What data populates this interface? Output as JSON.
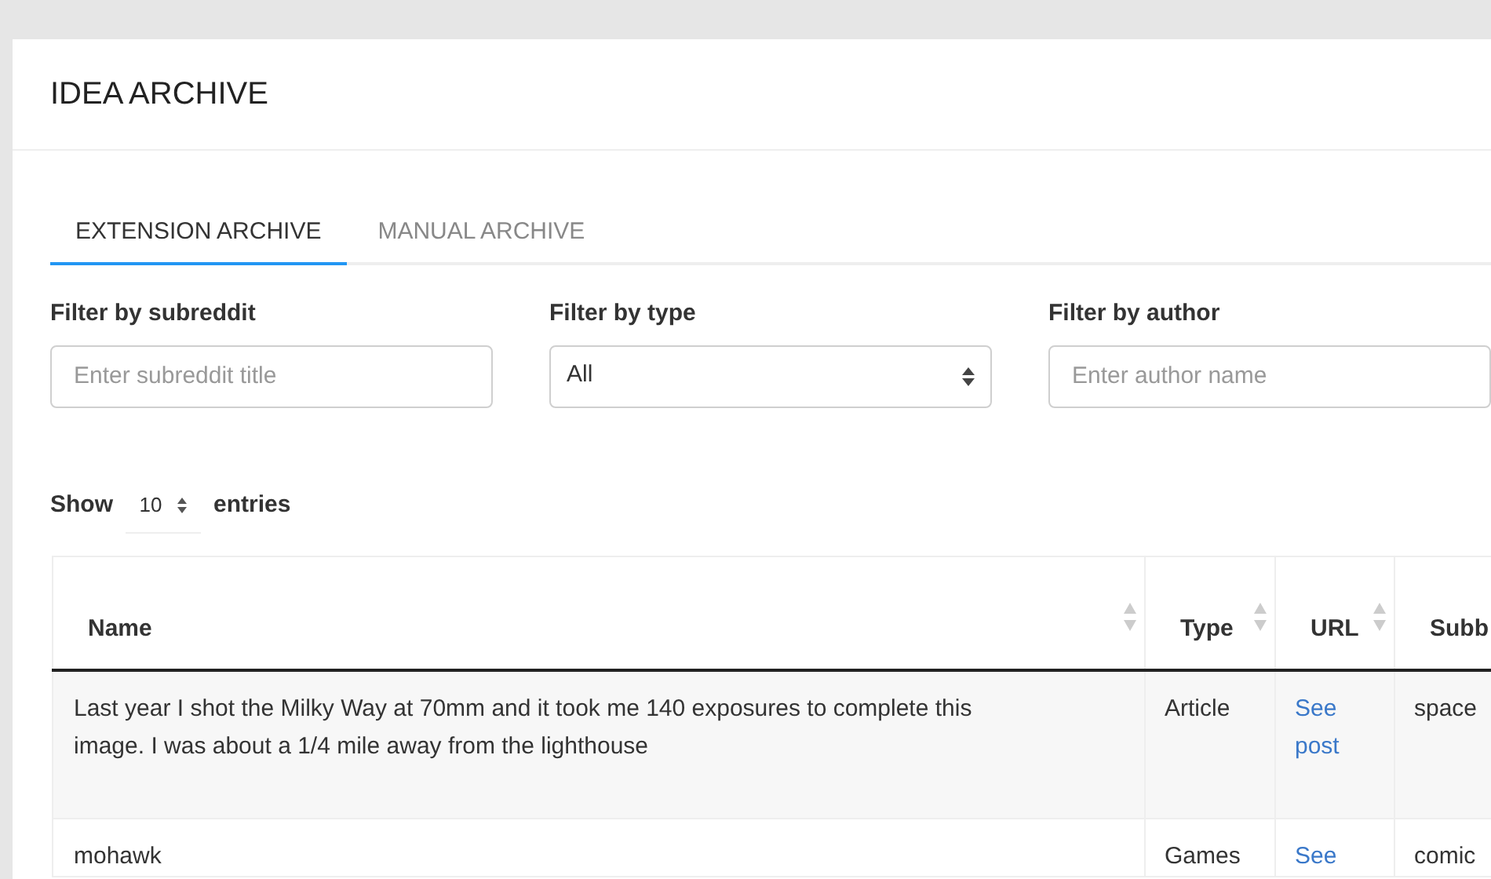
{
  "page": {
    "title": "IDEA ARCHIVE"
  },
  "tabs": [
    {
      "label": "EXTENSION ARCHIVE",
      "selected": true
    },
    {
      "label": "MANUAL ARCHIVE",
      "selected": false
    }
  ],
  "filters": [
    {
      "label": "Filter by subreddit",
      "kind": "text",
      "placeholder": "Enter subreddit title"
    },
    {
      "label": "Filter by type",
      "kind": "select",
      "value": "All"
    },
    {
      "label": "Filter by author",
      "kind": "text",
      "placeholder": "Enter author name"
    }
  ],
  "length": {
    "prefix": "Show",
    "value": "10",
    "suffix": "entries"
  },
  "table": {
    "columns": [
      "Name",
      "Type",
      "URL",
      "Subb"
    ],
    "rows": [
      {
        "cells": [
          "Last year I shot the Milky Way at 70mm and it took me 140 exposures to complete this image. I was about a 1/4 mile away from the lighthouse",
          "Article",
          "See post",
          "space"
        ]
      },
      {
        "cells": [
          "mohawk",
          "Games",
          "See",
          "comic"
        ]
      }
    ]
  }
}
